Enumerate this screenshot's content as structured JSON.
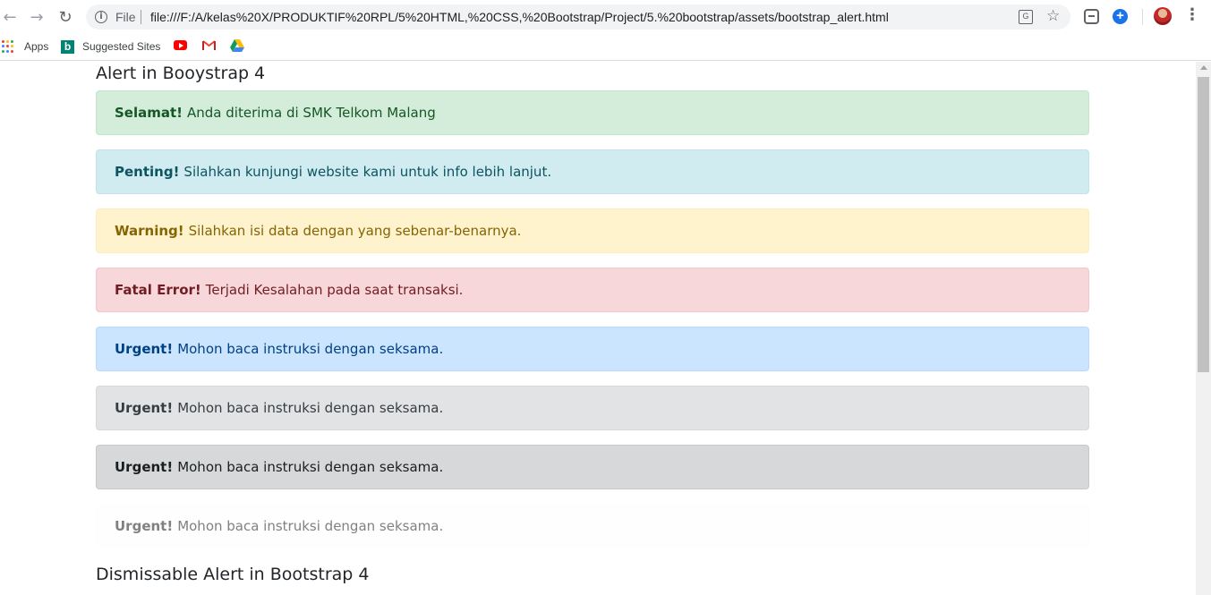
{
  "browser": {
    "file_label": "File",
    "url": "file:///F:/A/kelas%20X/PRODUKTIF%20RPL/5%20HTML,%20CSS,%20Bootstrap/Project/5.%20bootstrap/assets/bootstrap_alert.html",
    "bookmarks": [
      {
        "label": "Apps",
        "icon": "apps-grid-icon"
      },
      {
        "label": "Suggested Sites",
        "icon": "bing-icon"
      },
      {
        "label": "",
        "icon": "youtube-icon"
      },
      {
        "label": "",
        "icon": "gmail-icon"
      },
      {
        "label": "",
        "icon": "drive-icon"
      }
    ]
  },
  "page": {
    "heading": "Alert in Booystrap 4",
    "alerts": [
      {
        "type": "success",
        "strong": "Selamat!",
        "text": "Anda diterima di SMK Telkom Malang"
      },
      {
        "type": "info",
        "strong": "Penting!",
        "text": "Silahkan kunjungi website kami untuk info lebih lanjut."
      },
      {
        "type": "warning",
        "strong": "Warning!",
        "text": "Silahkan isi data dengan yang sebenar-benarnya."
      },
      {
        "type": "danger",
        "strong": "Fatal Error!",
        "text": "Terjadi Kesalahan pada saat transaksi."
      },
      {
        "type": "primary",
        "strong": "Urgent!",
        "text": "Mohon baca instruksi dengan seksama."
      },
      {
        "type": "secondary",
        "strong": "Urgent!",
        "text": "Mohon baca instruksi dengan seksama."
      },
      {
        "type": "dark",
        "strong": "Urgent!",
        "text": "Mohon baca instruksi dengan seksama."
      },
      {
        "type": "light",
        "strong": "Urgent!",
        "text": "Mohon baca instruksi dengan seksama."
      }
    ],
    "heading2": "Dismissable Alert in Bootstrap 4"
  },
  "colors": {
    "success_bg": "#d4edda",
    "info_bg": "#d1ecf1",
    "warning_bg": "#fff3cd",
    "danger_bg": "#f8d7da",
    "primary_bg": "#cce5ff",
    "secondary_bg": "#e2e3e5",
    "dark_bg": "#d6d8d9",
    "light_bg": "#fefefe"
  }
}
